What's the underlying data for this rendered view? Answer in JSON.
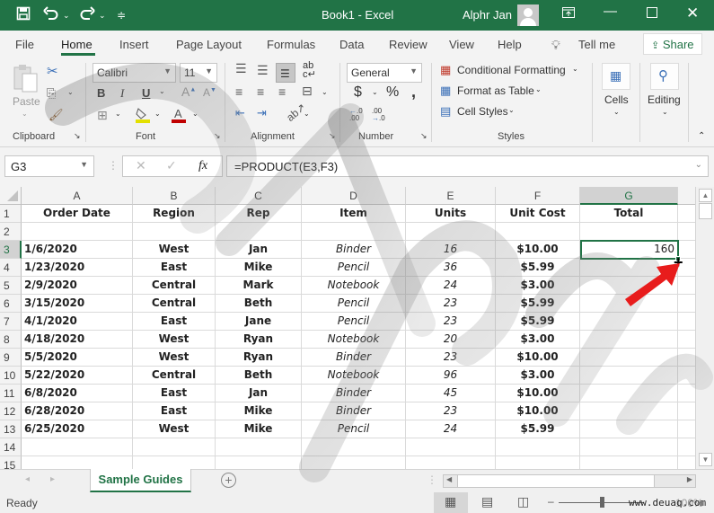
{
  "titlebar": {
    "title": "Book1  -  Excel",
    "user": "Alphr Jan",
    "icons": [
      "save-icon",
      "undo-icon",
      "redo-icon",
      "customize-qat-icon",
      "ribbon-display-icon",
      "minimize-icon",
      "maximize-icon",
      "close-icon"
    ]
  },
  "tabs": [
    {
      "label": "File"
    },
    {
      "label": "Home",
      "active": true
    },
    {
      "label": "Insert"
    },
    {
      "label": "Page Layout"
    },
    {
      "label": "Formulas"
    },
    {
      "label": "Data"
    },
    {
      "label": "Review"
    },
    {
      "label": "View"
    },
    {
      "label": "Help"
    }
  ],
  "tell_me": "Tell me",
  "share": "Share",
  "ribbon": {
    "clipboard": {
      "label": "Clipboard",
      "paste": "Paste"
    },
    "font": {
      "label": "Font",
      "name": "Calibri",
      "size": "11",
      "bold": "B",
      "italic": "I",
      "underline": "U"
    },
    "alignment": {
      "label": "Alignment"
    },
    "number": {
      "label": "Number",
      "format": "General",
      "currency": "$",
      "percent": "%",
      "comma": ","
    },
    "styles": {
      "label": "Styles",
      "conditional": "Conditional Formatting",
      "format_table": "Format as Table",
      "cell_styles": "Cell Styles"
    },
    "cells": {
      "label": "Cells"
    },
    "editing": {
      "label": "Editing"
    }
  },
  "formula_bar": {
    "name_box": "G3",
    "fx": "fx",
    "formula": "=PRODUCT(E3,F3)"
  },
  "columns": [
    "A",
    "B",
    "C",
    "D",
    "E",
    "F",
    "G"
  ],
  "selected_column": "G",
  "selected_row": "3",
  "rows": [
    {
      "n": "1",
      "cells": [
        "Order Date",
        "Region",
        "Rep",
        "Item",
        "Units",
        "Unit Cost",
        "Total"
      ]
    },
    {
      "n": "2",
      "cells": [
        "",
        "",
        "",
        "",
        "",
        "",
        ""
      ]
    },
    {
      "n": "3",
      "cells": [
        "1/6/2020",
        "West",
        "Jan",
        "Binder",
        "16",
        "$10.00",
        "160"
      ]
    },
    {
      "n": "4",
      "cells": [
        "1/23/2020",
        "East",
        "Mike",
        "Pencil",
        "36",
        "$5.99",
        ""
      ]
    },
    {
      "n": "5",
      "cells": [
        "2/9/2020",
        "Central",
        "Mark",
        "Notebook",
        "24",
        "$3.00",
        ""
      ]
    },
    {
      "n": "6",
      "cells": [
        "3/15/2020",
        "Central",
        "Beth",
        "Pencil",
        "23",
        "$5.99",
        ""
      ]
    },
    {
      "n": "7",
      "cells": [
        "4/1/2020",
        "East",
        "Jane",
        "Pencil",
        "23",
        "$5.99",
        ""
      ]
    },
    {
      "n": "8",
      "cells": [
        "4/18/2020",
        "West",
        "Ryan",
        "Notebook",
        "20",
        "$3.00",
        ""
      ]
    },
    {
      "n": "9",
      "cells": [
        "5/5/2020",
        "West",
        "Ryan",
        "Binder",
        "23",
        "$10.00",
        ""
      ]
    },
    {
      "n": "10",
      "cells": [
        "5/22/2020",
        "Central",
        "Beth",
        "Notebook",
        "96",
        "$3.00",
        ""
      ]
    },
    {
      "n": "11",
      "cells": [
        "6/8/2020",
        "East",
        "Jan",
        "Binder",
        "45",
        "$10.00",
        ""
      ]
    },
    {
      "n": "12",
      "cells": [
        "6/28/2020",
        "East",
        "Mike",
        "Binder",
        "23",
        "$10.00",
        ""
      ]
    },
    {
      "n": "13",
      "cells": [
        "6/25/2020",
        "West",
        "Mike",
        "Pencil",
        "24",
        "$5.99",
        ""
      ]
    },
    {
      "n": "14",
      "cells": [
        "",
        "",
        "",
        "",
        "",
        "",
        ""
      ]
    },
    {
      "n": "15",
      "cells": [
        "",
        "",
        "",
        "",
        "",
        "",
        ""
      ]
    }
  ],
  "sheet_tab": "Sample Guides",
  "status": "Ready",
  "zoom": "100%",
  "watermark_text": "Alphr",
  "site_watermark": "www.deuaq.com",
  "colors": {
    "accent": "#217346",
    "arrow": "#e81c1c"
  }
}
